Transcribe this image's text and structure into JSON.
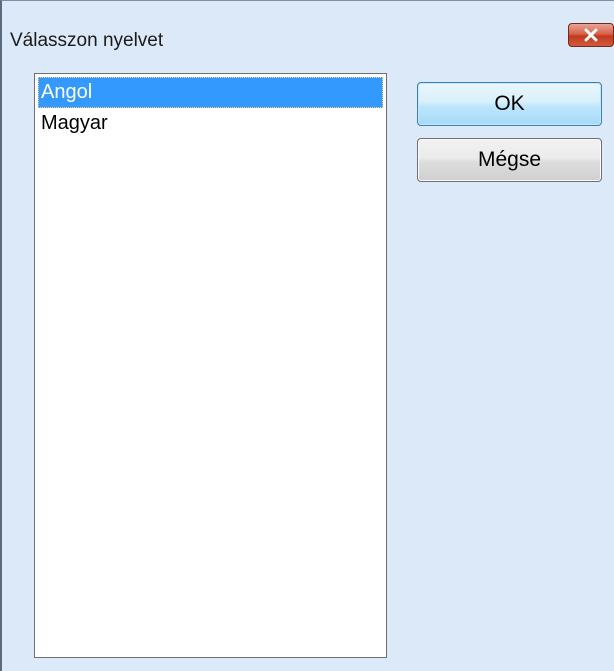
{
  "window": {
    "title": "Válasszon nyelvet",
    "close_icon": "close-icon"
  },
  "language_list": {
    "items": [
      {
        "label": "Angol",
        "selected": true
      },
      {
        "label": "Magyar",
        "selected": false
      }
    ]
  },
  "buttons": {
    "ok_label": "OK",
    "cancel_label": "Mégse"
  },
  "colors": {
    "window_background": "#dbe9f8",
    "selection": "#3399ff",
    "close_button": "#c1391f"
  }
}
